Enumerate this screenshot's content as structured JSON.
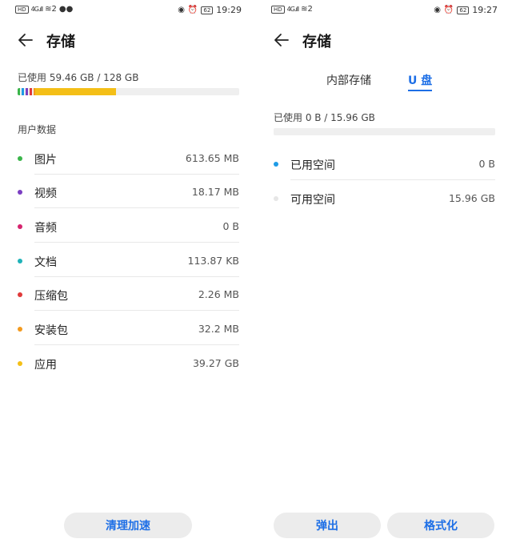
{
  "left": {
    "status": {
      "icons_left": "HD 4G",
      "signal": "4G.ıll",
      "wifi": "≋2",
      "battery": "62",
      "time": "19:29"
    },
    "title": "存储",
    "usage_label": "已使用 59.46 GB / 128 GB",
    "section_title": "用户数据",
    "categories": [
      {
        "label": "图片",
        "value": "613.65 MB",
        "color": "#3ab54a"
      },
      {
        "label": "视频",
        "value": "18.17 MB",
        "color": "#7b3fc2"
      },
      {
        "label": "音频",
        "value": "0 B",
        "color": "#d6246e"
      },
      {
        "label": "文档",
        "value": "113.87 KB",
        "color": "#1fb2b9"
      },
      {
        "label": "压缩包",
        "value": "2.26 MB",
        "color": "#e03a3a"
      },
      {
        "label": "安装包",
        "value": "32.2 MB",
        "color": "#f39a1e"
      },
      {
        "label": "应用",
        "value": "39.27 GB",
        "color": "#f4bf17"
      }
    ],
    "button_label": "清理加速"
  },
  "right": {
    "status": {
      "icons_left": "HD 4G",
      "signal": "4G.ıll",
      "wifi": "≋2",
      "battery": "62",
      "time": "19:27"
    },
    "title": "存储",
    "tabs": [
      "内部存储",
      "U 盘"
    ],
    "active_tab": "U 盘",
    "usage_label": "已使用 0 B / 15.96 GB",
    "rows": [
      {
        "label": "已用空间",
        "value": "0 B",
        "color": "#1e9be6"
      },
      {
        "label": "可用空间",
        "value": "15.96 GB",
        "color": "#e6e6e6"
      }
    ],
    "button_eject": "弹出",
    "button_format": "格式化"
  },
  "colors": {
    "accent": "#1e6fe6",
    "apps": "#f4bf17",
    "pill_bg": "#ececec"
  }
}
